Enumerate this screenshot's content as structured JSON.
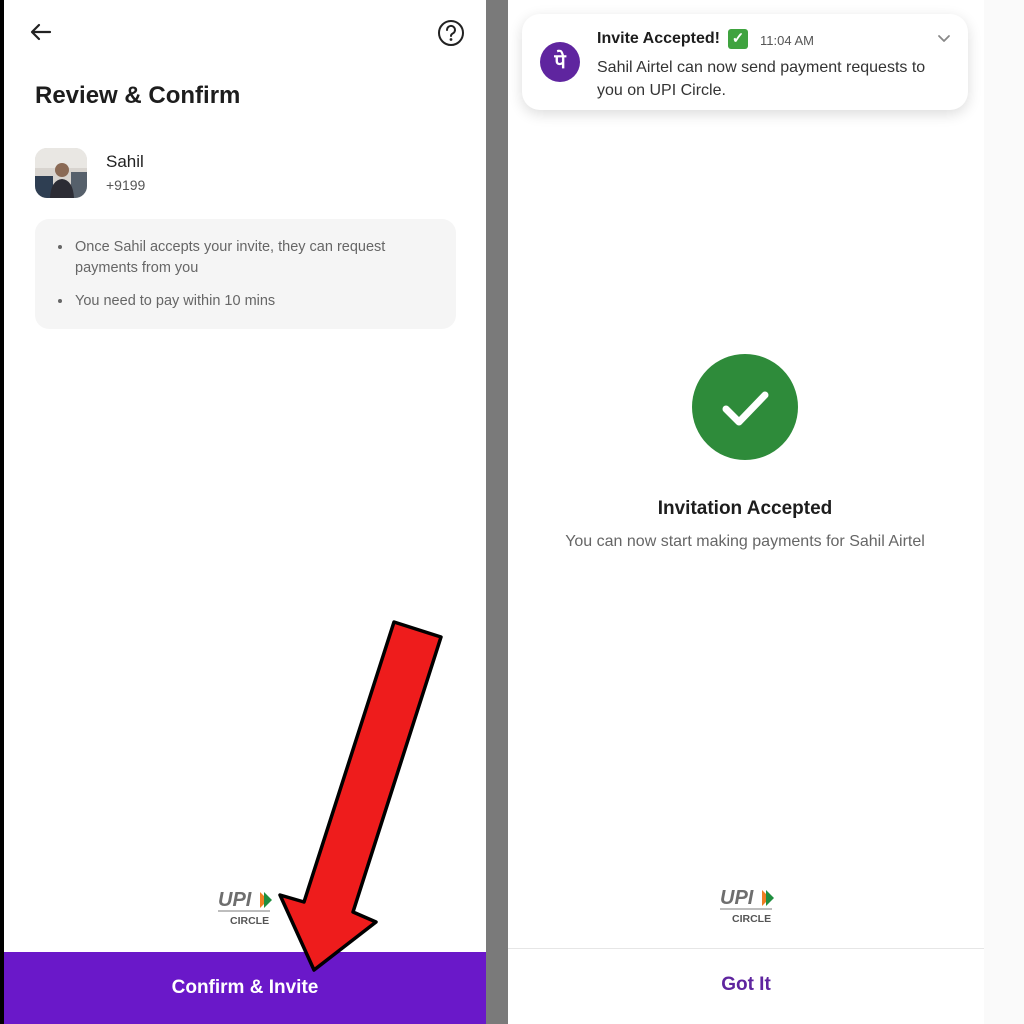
{
  "left_screen": {
    "title": "Review & Confirm",
    "contact": {
      "name": "Sahil",
      "phone": "+9199"
    },
    "info_points": [
      "Once Sahil accepts your invite, they can request payments from you",
      "You need to pay within 10 mins"
    ],
    "upi_logo": {
      "text": "UPI",
      "caption": "CIRCLE"
    },
    "confirm_button": "Confirm & Invite"
  },
  "notification": {
    "title": "Invite Accepted!",
    "check_emoji": "✓",
    "time": "11:04 AM",
    "message": "Sahil Airtel can now send payment requests to you on UPI Circle.",
    "app_icon_char": "पे"
  },
  "right_screen": {
    "title": "Invitation Accepted",
    "subtitle": "You can now start making payments for Sahil Airtel",
    "upi_logo": {
      "text": "UPI",
      "caption": "CIRCLE"
    },
    "got_it_button": "Got It"
  },
  "colors": {
    "brand_purple": "#6a18c9",
    "phonepe_purple": "#5f259f",
    "success_green": "#2e8b3a",
    "arrow_red": "#ee1c1c"
  }
}
